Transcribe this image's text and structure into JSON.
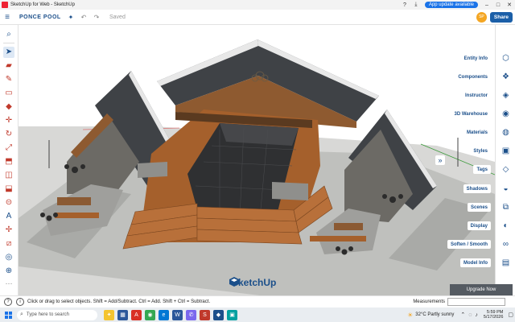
{
  "window": {
    "title": "SketchUp for Web - SketchUp",
    "update_label": "App update available",
    "controls": {
      "minimize": "–",
      "maximize": "□",
      "close": "✕"
    }
  },
  "toolbar": {
    "model_name": "PONCE POOL",
    "saved_label": "Saved",
    "avatar_initials": "SP",
    "share_label": "Share",
    "icons": [
      "menu-icon",
      "add-location-icon",
      "undo-icon",
      "redo-icon",
      "help-icon",
      "download-icon"
    ]
  },
  "left_tools": [
    "search-icon",
    "select-icon",
    "eraser-icon",
    "pencil-icon",
    "rectangle-icon",
    "paint-bucket-icon",
    "move-icon",
    "rotate-icon",
    "scale-icon",
    "push-pull-icon",
    "offset-icon",
    "follow-me-icon",
    "tape-measure-icon",
    "text-icon",
    "axes-icon",
    "section-plane-icon",
    "orbit-icon",
    "zoom-extents-icon",
    "more-icon"
  ],
  "right_panels": [
    {
      "label": "Entity Info",
      "icon": "entity-info-icon"
    },
    {
      "label": "Components",
      "icon": "components-icon"
    },
    {
      "label": "Instructor",
      "icon": "instructor-icon"
    },
    {
      "label": "3D Warehouse",
      "icon": "warehouse-icon"
    },
    {
      "label": "Materials",
      "icon": "materials-icon"
    },
    {
      "label": "Styles",
      "icon": "styles-icon"
    },
    {
      "label": "Tags",
      "icon": "tags-icon"
    },
    {
      "label": "Shadows",
      "icon": "shadows-icon"
    },
    {
      "label": "Scenes",
      "icon": "scenes-icon"
    },
    {
      "label": "Display",
      "icon": "display-icon"
    },
    {
      "label": "Soften / Smooth",
      "icon": "soften-icon"
    },
    {
      "label": "Model Info",
      "icon": "model-info-icon"
    }
  ],
  "tray_collapse_label": "»",
  "watermark": "SketchUp",
  "upgrade_label": "Upgrade Now",
  "status": {
    "hint": "Click or drag to select objects. Shift = Add/Subtract. Ctrl = Add. Shift + Ctrl = Subtract.",
    "measurements_label": "Measurements"
  },
  "taskbar": {
    "search_placeholder": "Type here to search",
    "weather_temp": "32°C",
    "weather_text": "Partly sunny",
    "time": "5:59 PM",
    "date": "5/17/2026"
  },
  "colors": {
    "brand": "#1b4f8a",
    "roof": "#3f4246",
    "wood": "#a5602c",
    "pool": "#2f3032",
    "concrete": "#bfc0bd",
    "accent_red": "#c0392b"
  }
}
